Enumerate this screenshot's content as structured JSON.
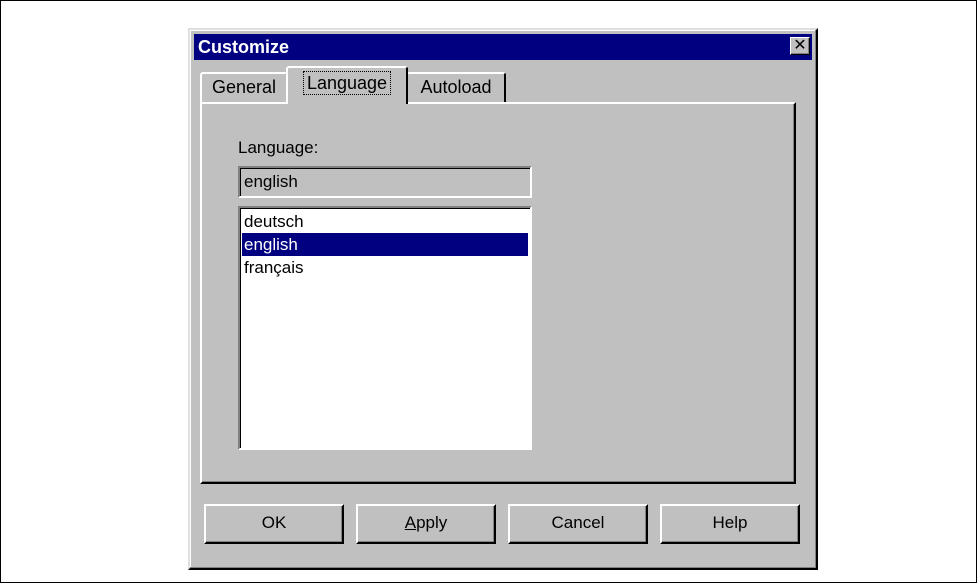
{
  "window": {
    "title": "Customize",
    "close_glyph": "✕"
  },
  "tabs": [
    {
      "label": "General",
      "active": false
    },
    {
      "label": "Language",
      "active": true
    },
    {
      "label": "Autoload",
      "active": false
    }
  ],
  "language_panel": {
    "label": "Language:",
    "current_value": "english",
    "options": [
      "deutsch",
      "english",
      "français"
    ],
    "selected": "english"
  },
  "buttons": {
    "ok": "OK",
    "apply_underlined": "A",
    "apply_rest": "pply",
    "cancel": "Cancel",
    "help": "Help"
  },
  "colors": {
    "titlebar": "#000080",
    "face": "#c0c0c0",
    "selection": "#000080"
  },
  "icons": {
    "close": "close-icon"
  }
}
